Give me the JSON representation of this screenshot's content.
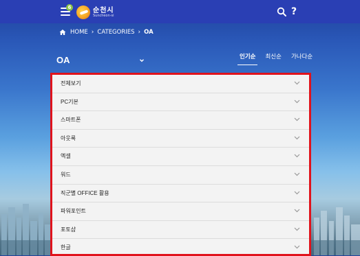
{
  "header": {
    "menu_badge": "6",
    "logo_text_ko": "순천시",
    "logo_text_en": "Suncheon-si"
  },
  "breadcrumb": {
    "home": "HOME",
    "categories": "CATEGORIES",
    "current": "OA"
  },
  "page": {
    "title": "OA"
  },
  "sort_tabs": [
    {
      "label": "인기순",
      "active": true
    },
    {
      "label": "최신순",
      "active": false
    },
    {
      "label": "가나다순",
      "active": false
    }
  ],
  "categories": [
    {
      "label": "전체보기"
    },
    {
      "label": "PC기본"
    },
    {
      "label": "스마트폰"
    },
    {
      "label": "아웃룩"
    },
    {
      "label": "엑셀"
    },
    {
      "label": "워드"
    },
    {
      "label": "직군별 OFFICE 활용"
    },
    {
      "label": "파워포인트"
    },
    {
      "label": "포토샵"
    },
    {
      "label": "한글"
    }
  ],
  "colors": {
    "topbar": "#2a3fb4",
    "highlight_border": "#e0131c",
    "badge": "#8bc34a"
  }
}
